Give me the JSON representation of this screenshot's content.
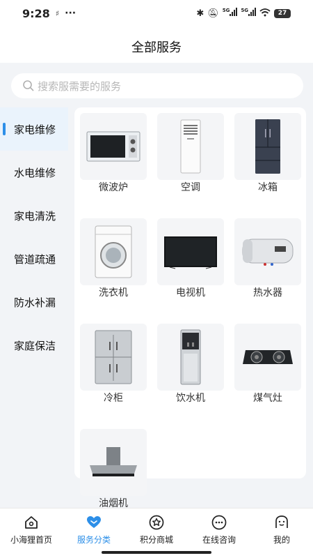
{
  "status": {
    "time": "9:28",
    "battery": "27",
    "net": "5G"
  },
  "header": {
    "title": "全部服务"
  },
  "search": {
    "placeholder": "搜索服需要的服务"
  },
  "sidebar": {
    "items": [
      {
        "label": "家电维修",
        "active": true
      },
      {
        "label": "水电维修",
        "active": false
      },
      {
        "label": "家电清洗",
        "active": false
      },
      {
        "label": "管道疏通",
        "active": false
      },
      {
        "label": "防水补漏",
        "active": false
      },
      {
        "label": "家庭保洁",
        "active": false
      }
    ]
  },
  "services": [
    {
      "label": "微波炉",
      "icon": "microwave-icon"
    },
    {
      "label": "空调",
      "icon": "air-conditioner-icon"
    },
    {
      "label": "冰箱",
      "icon": "refrigerator-icon"
    },
    {
      "label": "洗衣机",
      "icon": "washing-machine-icon"
    },
    {
      "label": "电视机",
      "icon": "television-icon"
    },
    {
      "label": "热水器",
      "icon": "water-heater-icon"
    },
    {
      "label": "冷柜",
      "icon": "freezer-icon"
    },
    {
      "label": "饮水机",
      "icon": "water-dispenser-icon"
    },
    {
      "label": "煤气灶",
      "icon": "gas-stove-icon"
    },
    {
      "label": "油烟机",
      "icon": "range-hood-icon"
    }
  ],
  "tabbar": {
    "items": [
      {
        "label": "小海狸首页",
        "icon": "home-icon"
      },
      {
        "label": "服务分类",
        "icon": "heart-icon",
        "active": true
      },
      {
        "label": "积分商城",
        "icon": "star-badge-icon"
      },
      {
        "label": "在线咨询",
        "icon": "chat-icon"
      },
      {
        "label": "我的",
        "icon": "profile-icon"
      }
    ]
  },
  "colors": {
    "accent": "#2d8fe8",
    "background": "#f2f4f7",
    "active_side": "#eaf3fc"
  }
}
